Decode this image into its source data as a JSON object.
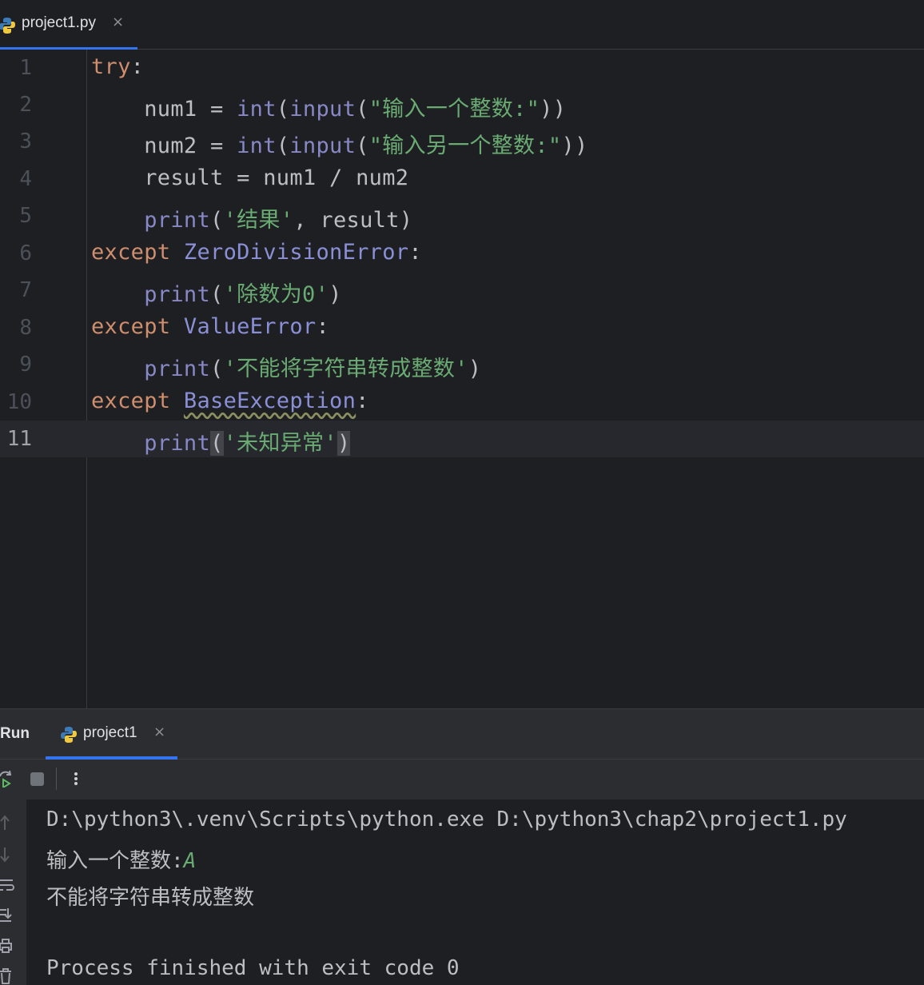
{
  "editor_tab": {
    "label": "project1.py",
    "close": "×"
  },
  "code_lines": [
    {
      "num": "1"
    },
    {
      "num": "2"
    },
    {
      "num": "3"
    },
    {
      "num": "4"
    },
    {
      "num": "5"
    },
    {
      "num": "6"
    },
    {
      "num": "7"
    },
    {
      "num": "8"
    },
    {
      "num": "9"
    },
    {
      "num": "10"
    },
    {
      "num": "11"
    }
  ],
  "code": {
    "l1_kw": "try",
    "colon": ":",
    "l2_var": "num1 = ",
    "int": "int",
    "input": "input",
    "paren_open": "(",
    "l2_str": "\"输入一个整数:\"",
    "close2": "))",
    "l3_var": "num2 = ",
    "l3_str": "\"输入另一个整数:\"",
    "l4": "result = num1 / num2",
    "print": "print",
    "l5_str": "'结果'",
    "l5_rest": ", result)",
    "except": "except",
    "l6_cls": "ZeroDivisionError",
    "l7_str": "'除数为0'",
    "close1": ")",
    "l8_cls": "ValueError",
    "l9_str": "'不能将字符串转成整数'",
    "l10_cls": "BaseException",
    "l11_str": "'未知异常'"
  },
  "run_panel": {
    "title": "Run",
    "tab_label": "project1",
    "tab_close": "×",
    "console": {
      "command": "D:\\python3\\.venv\\Scripts\\python.exe D:\\python3\\chap2\\project1.py",
      "prompt": "输入一个整数:",
      "user_input": "A",
      "output": "不能将字符串转成整数",
      "exit": "Process finished with exit code 0"
    }
  },
  "colors": {
    "accent": "#3574f0",
    "keyword": "#cf8e6d",
    "string": "#6aab73",
    "builtin": "#8888c6"
  }
}
